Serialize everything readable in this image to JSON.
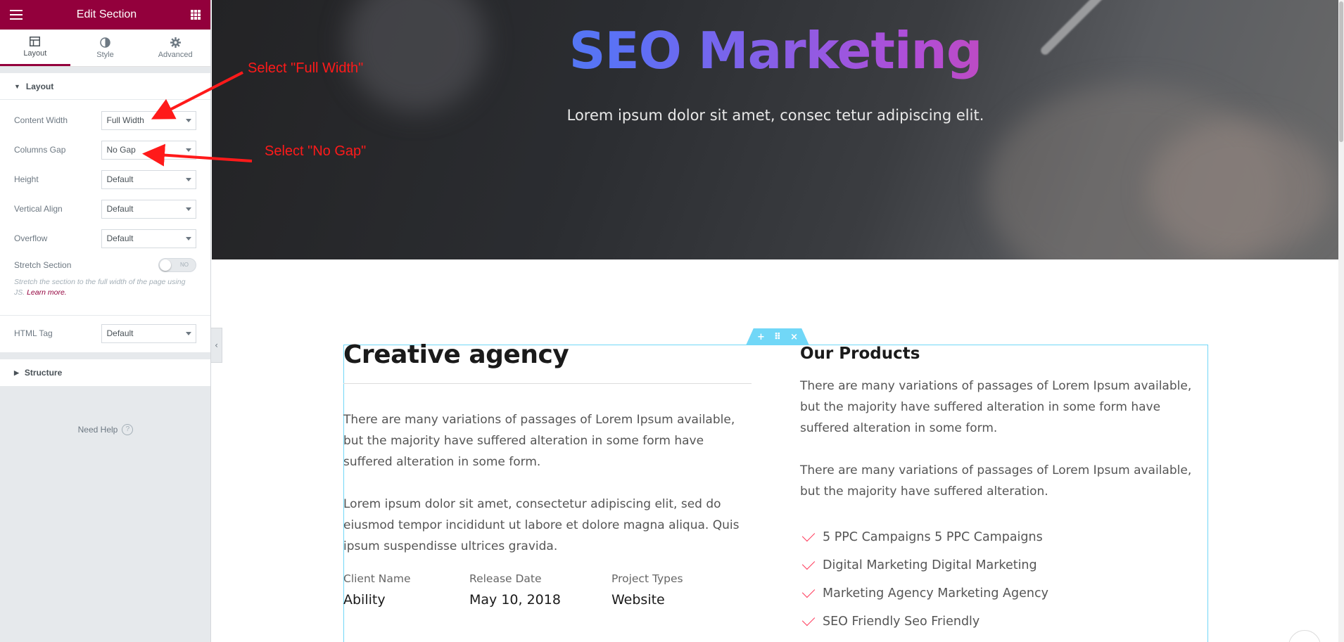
{
  "sidebar": {
    "header_title": "Edit Section",
    "tabs": [
      {
        "label": "Layout",
        "icon": "layout-icon"
      },
      {
        "label": "Style",
        "icon": "half-circle-icon"
      },
      {
        "label": "Advanced",
        "icon": "gear-icon"
      }
    ],
    "layout_section": {
      "title": "Layout",
      "controls": [
        {
          "label": "Content Width",
          "value": "Full Width"
        },
        {
          "label": "Columns Gap",
          "value": "No Gap"
        },
        {
          "label": "Height",
          "value": "Default"
        },
        {
          "label": "Vertical Align",
          "value": "Default"
        },
        {
          "label": "Overflow",
          "value": "Default"
        }
      ],
      "stretch": {
        "label": "Stretch Section",
        "toggle_text": "NO",
        "desc": "Stretch the section to the full width of the page using JS.",
        "link": "Learn more."
      },
      "html_tag": {
        "label": "HTML Tag",
        "value": "Default"
      }
    },
    "structure_title": "Structure",
    "need_help": "Need Help",
    "help_glyph": "?"
  },
  "annotations": {
    "full_width": "Select \"Full Width\"",
    "no_gap": "Select \"No Gap\""
  },
  "hero": {
    "title": "SEO Marketing",
    "subtitle": "Lorem ipsum dolor sit amet, consec tetur adipiscing elit."
  },
  "section_handle": {
    "add": "+",
    "move": "⠿",
    "close": "×"
  },
  "left": {
    "heading": "Creative agency",
    "p1": "There are many variations of passages of Lorem Ipsum available, but the majority have suffered alteration in some form have suffered alteration in some form.",
    "p2": "Lorem ipsum dolor sit amet, consectetur adipiscing elit, sed do eiusmod tempor incididunt ut labore et dolore magna aliqua. Quis ipsum suspendisse ultrices gravida.",
    "meta": [
      {
        "key": "Client Name",
        "value": "Ability"
      },
      {
        "key": "Release Date",
        "value": "May 10, 2018"
      },
      {
        "key": "Project Types",
        "value": "Website"
      }
    ]
  },
  "right": {
    "heading": "Our Products",
    "p1": "There are many variations of passages of Lorem Ipsum available, but the majority have suffered alteration in some form have suffered alteration in some form.",
    "p2": "There are many variations of passages of Lorem Ipsum available, but the majority have suffered alteration.",
    "features": [
      "5 PPC Campaigns 5 PPC Campaigns",
      "Digital Marketing Digital Marketing",
      "Marketing Agency Marketing Agency",
      "SEO Friendly Seo Friendly"
    ]
  },
  "colors": {
    "brand": "#93003c",
    "accent_red": "#ff3b5c",
    "frame": "#71d7f7",
    "annotation": "#ff1a1a"
  }
}
